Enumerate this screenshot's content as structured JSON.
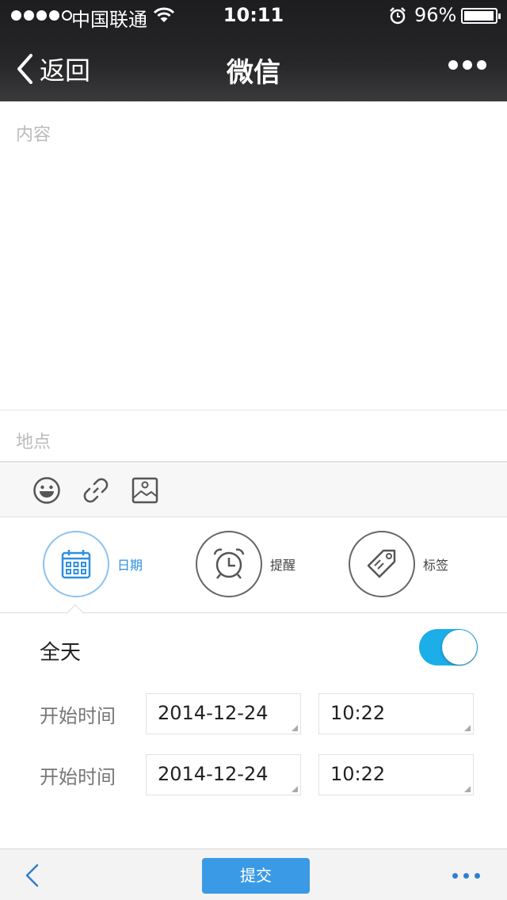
{
  "status_bar": {
    "signal_dots": "●●●●○",
    "carrier": "中国联通",
    "time": "10:11",
    "battery_percent": "96%",
    "battery_level": 0.96
  },
  "nav": {
    "back_label": "返回",
    "title": "微信"
  },
  "editor": {
    "content_placeholder": "内容",
    "location_placeholder": "地点"
  },
  "toolbar": {
    "icons": [
      "smiley-icon",
      "link-icon",
      "image-icon"
    ]
  },
  "tabs": [
    {
      "label": "日期",
      "icon": "calendar-icon",
      "active": true
    },
    {
      "label": "提醒",
      "icon": "alarm-clock-icon",
      "active": false
    },
    {
      "label": "标签",
      "icon": "tag-icon",
      "active": false
    }
  ],
  "form": {
    "all_day_label": "全天",
    "all_day_on": true,
    "rows": [
      {
        "label": "开始时间",
        "date": "2014-12-24",
        "time": "10:22"
      },
      {
        "label": "开始时间",
        "date": "2014-12-24",
        "time": "10:22"
      }
    ]
  },
  "bottom_bar": {
    "submit_label": "提交"
  },
  "colors": {
    "accent": "#3a9ae6",
    "toggle_on": "#1baee8",
    "active_tab": "#2f8fe0",
    "nav_bg": "#1d1d1f"
  }
}
